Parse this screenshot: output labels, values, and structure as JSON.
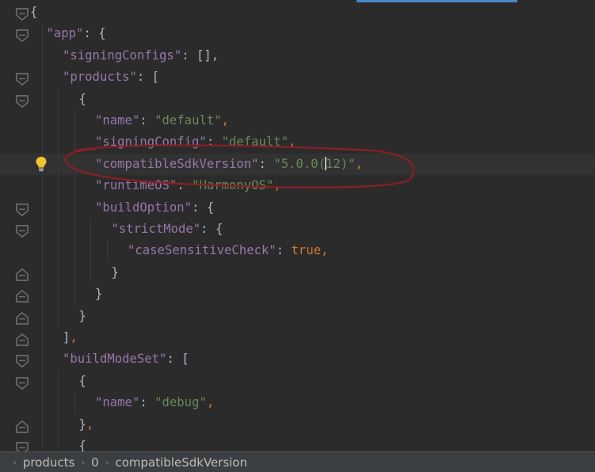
{
  "editor": {
    "lines": [
      {
        "indent": 0,
        "tokens": [
          {
            "t": "{",
            "c": "b"
          }
        ]
      },
      {
        "indent": 1,
        "tokens": [
          {
            "t": "\"app\"",
            "c": "k"
          },
          {
            "t": ": {",
            "c": "b"
          }
        ]
      },
      {
        "indent": 2,
        "tokens": [
          {
            "t": "\"signingConfigs\"",
            "c": "k"
          },
          {
            "t": ": [],",
            "c": "b"
          }
        ]
      },
      {
        "indent": 2,
        "tokens": [
          {
            "t": "\"products\"",
            "c": "k"
          },
          {
            "t": ": [",
            "c": "b"
          }
        ]
      },
      {
        "indent": 3,
        "tokens": [
          {
            "t": "{",
            "c": "b"
          }
        ]
      },
      {
        "indent": 4,
        "tokens": [
          {
            "t": "\"name\"",
            "c": "k"
          },
          {
            "t": ": ",
            "c": "b"
          },
          {
            "t": "\"default\"",
            "c": "s"
          },
          {
            "t": ",",
            "c": "p"
          }
        ]
      },
      {
        "indent": 4,
        "tokens": [
          {
            "t": "\"signingConfig\"",
            "c": "k"
          },
          {
            "t": ": ",
            "c": "b"
          },
          {
            "t": "\"default\"",
            "c": "s"
          },
          {
            "t": ",",
            "c": "p"
          }
        ]
      },
      {
        "indent": 4,
        "current": true,
        "tokens": [
          {
            "t": "\"compatibleSdkVersion\"",
            "c": "k"
          },
          {
            "t": ": ",
            "c": "b"
          },
          {
            "t": "\"5.0.0(",
            "c": "s"
          },
          {
            "t": "CARET",
            "c": "caret"
          },
          {
            "t": "12)\"",
            "c": "s"
          },
          {
            "t": ",",
            "c": "p"
          }
        ]
      },
      {
        "indent": 4,
        "tokens": [
          {
            "t": "\"runtimeOS\"",
            "c": "k"
          },
          {
            "t": ": ",
            "c": "b"
          },
          {
            "t": "\"HarmonyOS\"",
            "c": "s"
          },
          {
            "t": ",",
            "c": "p"
          }
        ]
      },
      {
        "indent": 4,
        "tokens": [
          {
            "t": "\"buildOption\"",
            "c": "k"
          },
          {
            "t": ": {",
            "c": "b"
          }
        ]
      },
      {
        "indent": 5,
        "tokens": [
          {
            "t": "\"strictMode\"",
            "c": "k"
          },
          {
            "t": ": {",
            "c": "b"
          }
        ]
      },
      {
        "indent": 6,
        "tokens": [
          {
            "t": "\"caseSensitiveCheck\"",
            "c": "k"
          },
          {
            "t": ": ",
            "c": "b"
          },
          {
            "t": "true",
            "c": "p"
          },
          {
            "t": ",",
            "c": "p"
          }
        ]
      },
      {
        "indent": 5,
        "tokens": [
          {
            "t": "}",
            "c": "b"
          }
        ]
      },
      {
        "indent": 4,
        "tokens": [
          {
            "t": "}",
            "c": "b"
          }
        ]
      },
      {
        "indent": 3,
        "tokens": [
          {
            "t": "}",
            "c": "b"
          }
        ]
      },
      {
        "indent": 2,
        "tokens": [
          {
            "t": "]",
            "c": "b"
          },
          {
            "t": ",",
            "c": "p"
          }
        ]
      },
      {
        "indent": 2,
        "tokens": [
          {
            "t": "\"buildModeSet\"",
            "c": "k"
          },
          {
            "t": ": [",
            "c": "b"
          }
        ]
      },
      {
        "indent": 3,
        "tokens": [
          {
            "t": "{",
            "c": "b"
          }
        ]
      },
      {
        "indent": 4,
        "tokens": [
          {
            "t": "\"name\"",
            "c": "k"
          },
          {
            "t": ": ",
            "c": "b"
          },
          {
            "t": "\"debug\"",
            "c": "s"
          },
          {
            "t": ",",
            "c": "p"
          }
        ]
      },
      {
        "indent": 3,
        "tokens": [
          {
            "t": "}",
            "c": "b"
          },
          {
            "t": ",",
            "c": "p"
          }
        ]
      },
      {
        "indent": 3,
        "tokens": [
          {
            "t": "{",
            "c": "b"
          }
        ]
      }
    ],
    "fold_markers": [
      {
        "line": 0,
        "type": "open"
      },
      {
        "line": 1,
        "type": "open"
      },
      {
        "line": 3,
        "type": "open"
      },
      {
        "line": 4,
        "type": "open"
      },
      {
        "line": 9,
        "type": "open"
      },
      {
        "line": 10,
        "type": "open"
      },
      {
        "line": 12,
        "type": "close"
      },
      {
        "line": 13,
        "type": "close"
      },
      {
        "line": 14,
        "type": "close"
      },
      {
        "line": 15,
        "type": "close"
      },
      {
        "line": 16,
        "type": "open"
      },
      {
        "line": 17,
        "type": "open"
      },
      {
        "line": 19,
        "type": "close"
      },
      {
        "line": 20,
        "type": "open"
      }
    ],
    "intention_bulb_line": 7,
    "icons": {
      "bulb": "lightbulb-icon",
      "fold_open": "fold-open-icon",
      "fold_close": "fold-close-icon"
    },
    "annotation_color": "#8b1e24"
  },
  "breadcrumb": {
    "items": [
      "products",
      "0",
      "compatibleSdkVersion"
    ]
  },
  "colors": {
    "background": "#2b2b2b",
    "key": "#9876aa",
    "string": "#6a8759",
    "keyword": "#cc7832"
  }
}
